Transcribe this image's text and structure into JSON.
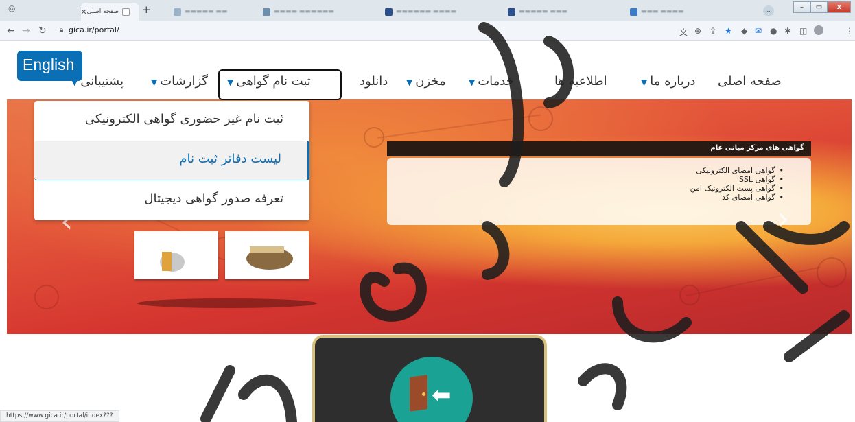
{
  "browser": {
    "active_tab_title": "صفحه اصلی",
    "url": "gica.ir/portal/",
    "new_tab": "+",
    "close_tab": "✕",
    "status_url": "https://www.gica.ir/portal/index???"
  },
  "site": {
    "english_button": "English",
    "menu": {
      "home": "صفحه اصلی",
      "about": "درباره ما",
      "news": "اطلاعیه ها",
      "services": "خدمات",
      "repository": "مخزن",
      "download": "دانلود",
      "cert_registration": "ثبت نام گواهی",
      "reports": "گزارشات",
      "support": "پشتیبانی"
    },
    "dropdown": [
      "ثبت نام غیر حضوری گواهی الکترونیکی",
      "لیست دفاتر ثبت نام",
      "تعرفه صدور گواهی دیجیتال"
    ],
    "panel": {
      "heading": "گواهی های مرکز میانی عام",
      "items": [
        "گواهی امضای الکترونیکی",
        "گواهی SSL",
        "گواهی پست الکترونیک امن",
        "گواهی امضای کد"
      ]
    },
    "slider": {
      "slide_count": 5,
      "active_index": 1
    }
  },
  "colors": {
    "brand_blue": "#0b6fb6",
    "teal_icon": "#1aa394",
    "card_border": "#d8c17c"
  }
}
